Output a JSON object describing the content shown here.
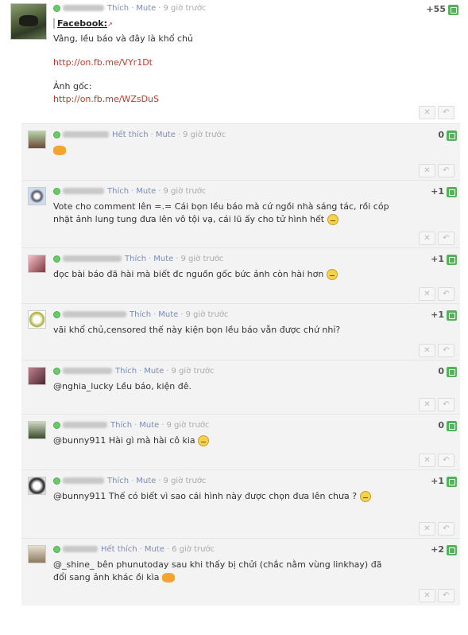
{
  "post": {
    "like_label": "Thích",
    "mute_label": "Mute",
    "time": "9 giờ trước",
    "score": "+55",
    "facebook_label": "Facebook:",
    "lines": [
      "Vâng, lều báo và đây là khổ chủ",
      "http://on.fb.me/VYr1Dt",
      "Ảnh gốc:",
      "http://on.fb.me/WZsDuS"
    ]
  },
  "replies": [
    {
      "like": "Hết thích",
      "mute": "Mute",
      "time": "9 giờ trước",
      "score": "0",
      "text": "",
      "emoji": "hands"
    },
    {
      "like": "Thích",
      "mute": "Mute",
      "time": "9 giờ trước",
      "score": "+1",
      "text": "Vote cho comment lên =.= Cái bọn lều báo mà cứ ngồi nhà sáng tác, rồi cóp nhặt ảnh lung tung đưa lên vô tội vạ, cái lũ ấy cho tử hình hết",
      "emoji": "smiley"
    },
    {
      "like": "Thích",
      "mute": "Mute",
      "time": "9 giờ trước",
      "score": "+1",
      "text": "đọc bài báo đã hài mà biết đc nguồn gốc bức ảnh còn hài hơn",
      "emoji": "smiley"
    },
    {
      "like": "Thích",
      "mute": "Mute",
      "time": "9 giờ trước",
      "score": "+1",
      "text": "vãi khổ chủ,censored thế này kiện bọn lều báo vẫn được chứ nhỉ?",
      "emoji": ""
    },
    {
      "like": "Thích",
      "mute": "Mute",
      "time": "9 giờ trước",
      "score": "0",
      "text": "@nghia_lucky Lều báo, kiện đê.",
      "emoji": ""
    },
    {
      "like": "Thích",
      "mute": "Mute",
      "time": "9 giờ trước",
      "score": "0",
      "text": "@bunny911 Hài gì mà hài cô kia",
      "emoji": "smiley"
    },
    {
      "like": "Thích",
      "mute": "Mute",
      "time": "9 giờ trước",
      "score": "+1",
      "text": "@bunny911 Thế có biết vì sao cái hình này được chọn đưa lên chưa ?",
      "emoji": "smiley"
    },
    {
      "like": "Hết thích",
      "mute": "Mute",
      "time": "6 giờ trước",
      "score": "+2",
      "text": "@_shine_ bên phunutoday sau khi thấy bị chửi (chắc nằm vùng linkhay) đã đổi sang ảnh khác ồi kìa",
      "emoji": "hands"
    }
  ],
  "icons": {
    "delete": "close-icon",
    "reply": "reply-icon",
    "vote": "vote-up-icon"
  },
  "colors": {
    "link": "#c0392b",
    "meta": "#7a8bb5",
    "vote": "#56b25a",
    "reply_bg": "#f3f3f3"
  }
}
